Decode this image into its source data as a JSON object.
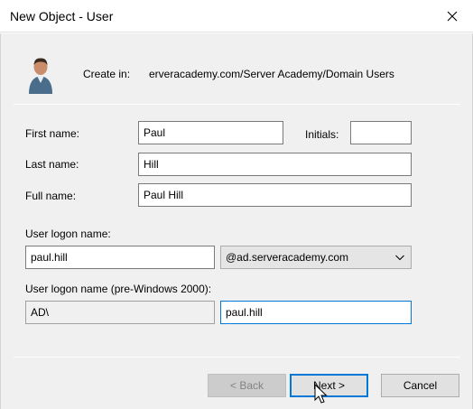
{
  "window": {
    "title": "New Object - User"
  },
  "create_in": {
    "label": "Create in:",
    "path": "erveracademy.com/Server Academy/Domain Users"
  },
  "form": {
    "first_name": {
      "label": "First name:",
      "value": "Paul"
    },
    "initials": {
      "label": "Initials:",
      "value": ""
    },
    "last_name": {
      "label": "Last name:",
      "value": "Hill"
    },
    "full_name": {
      "label": "Full name:",
      "value": "Paul Hill"
    },
    "logon_name": {
      "label": "User logon name:",
      "value": "paul.hill",
      "domain_suffix": "@ad.serveracademy.com"
    },
    "pre2000": {
      "label": "User logon name (pre-Windows 2000):",
      "domain": "AD\\",
      "value": "paul.hill"
    }
  },
  "buttons": {
    "back": "< Back",
    "next": "Next >",
    "cancel": "Cancel"
  },
  "icons": {
    "close": "close-icon",
    "user": "user-icon",
    "dropdown": "chevron-down-icon",
    "cursor": "mouse-cursor-icon"
  },
  "colors": {
    "focus_accent": "#0078d7",
    "dialog_bg": "#f0f0f0"
  }
}
